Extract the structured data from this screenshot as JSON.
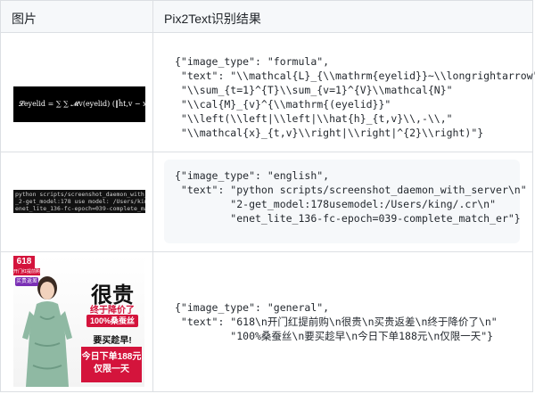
{
  "table": {
    "headers": [
      "图片",
      "Pix2Text识别结果"
    ],
    "rows": [
      {
        "image": {
          "kind": "formula-image",
          "formula_text": "𝓛eyelid = ∑ ∑ 𝓜v(eyelid) (‖ĥt,v − xt,v‖²)"
        },
        "code": [
          "{\"image_type\": \"formula\",",
          " \"text\": \"\\\\mathcal{L}_{\\\\mathrm{eyelid}}~\\\\longrightarrow\"",
          " \"\\\\sum_{t=1}^{T}\\\\sum_{v=1}^{V}\\\\mathcal{N}\"",
          " \"\\\\cal{M}_{v}^{\\\\mathrm{(eyelid}}\"",
          " \"\\\\left(\\\\left|\\\\left|\\\\hat{h}_{t,v}\\\\,-\\\\,\"",
          " \"\\\\mathcal{x}_{t,v}\\\\right|\\\\right|^{2}\\\\right)\"}"
        ]
      },
      {
        "image": {
          "kind": "terminal-image",
          "lines": [
            "python scripts/screenshot_daemon_with_server",
            "_2-get_model:178 use model: /Users/king/.cr",
            "enet_lite_136-fc-epoch=039-complete_match_er"
          ]
        },
        "code": [
          "{\"image_type\": \"english\",",
          " \"text\": \"python scripts/screenshot_daemon_with_server\\n\"",
          "         \"2-get_model:178usemodel:/Users/king/.cr\\n\"",
          "         \"enet_lite_136-fc-epoch=039-complete_match_er\"}"
        ]
      },
      {
        "image": {
          "kind": "ad-image",
          "badge": "618",
          "badge_sub": "开门红提前购",
          "tag": "买贵返差",
          "big": "很贵",
          "mid": "终于降价了",
          "silk": "100%桑蚕丝",
          "buy": "要买趁早!",
          "price_line1": "今日下单188元",
          "price_line2": "仅限一天"
        },
        "code": [
          "{\"image_type\": \"general\",",
          " \"text\": \"618\\n开门红提前购\\n很贵\\n买贵返差\\n终于降价了\\n\"",
          "         \"100%桑蚕丝\\n要买趁早\\n今日下单188元\\n仅限一天\"}"
        ]
      }
    ]
  },
  "colors": {
    "border": "#dcdfe3",
    "header_bg": "#f6f8fa",
    "code_key": "#116329",
    "code_string": "#0a3069",
    "ad_red": "#d4143c"
  }
}
